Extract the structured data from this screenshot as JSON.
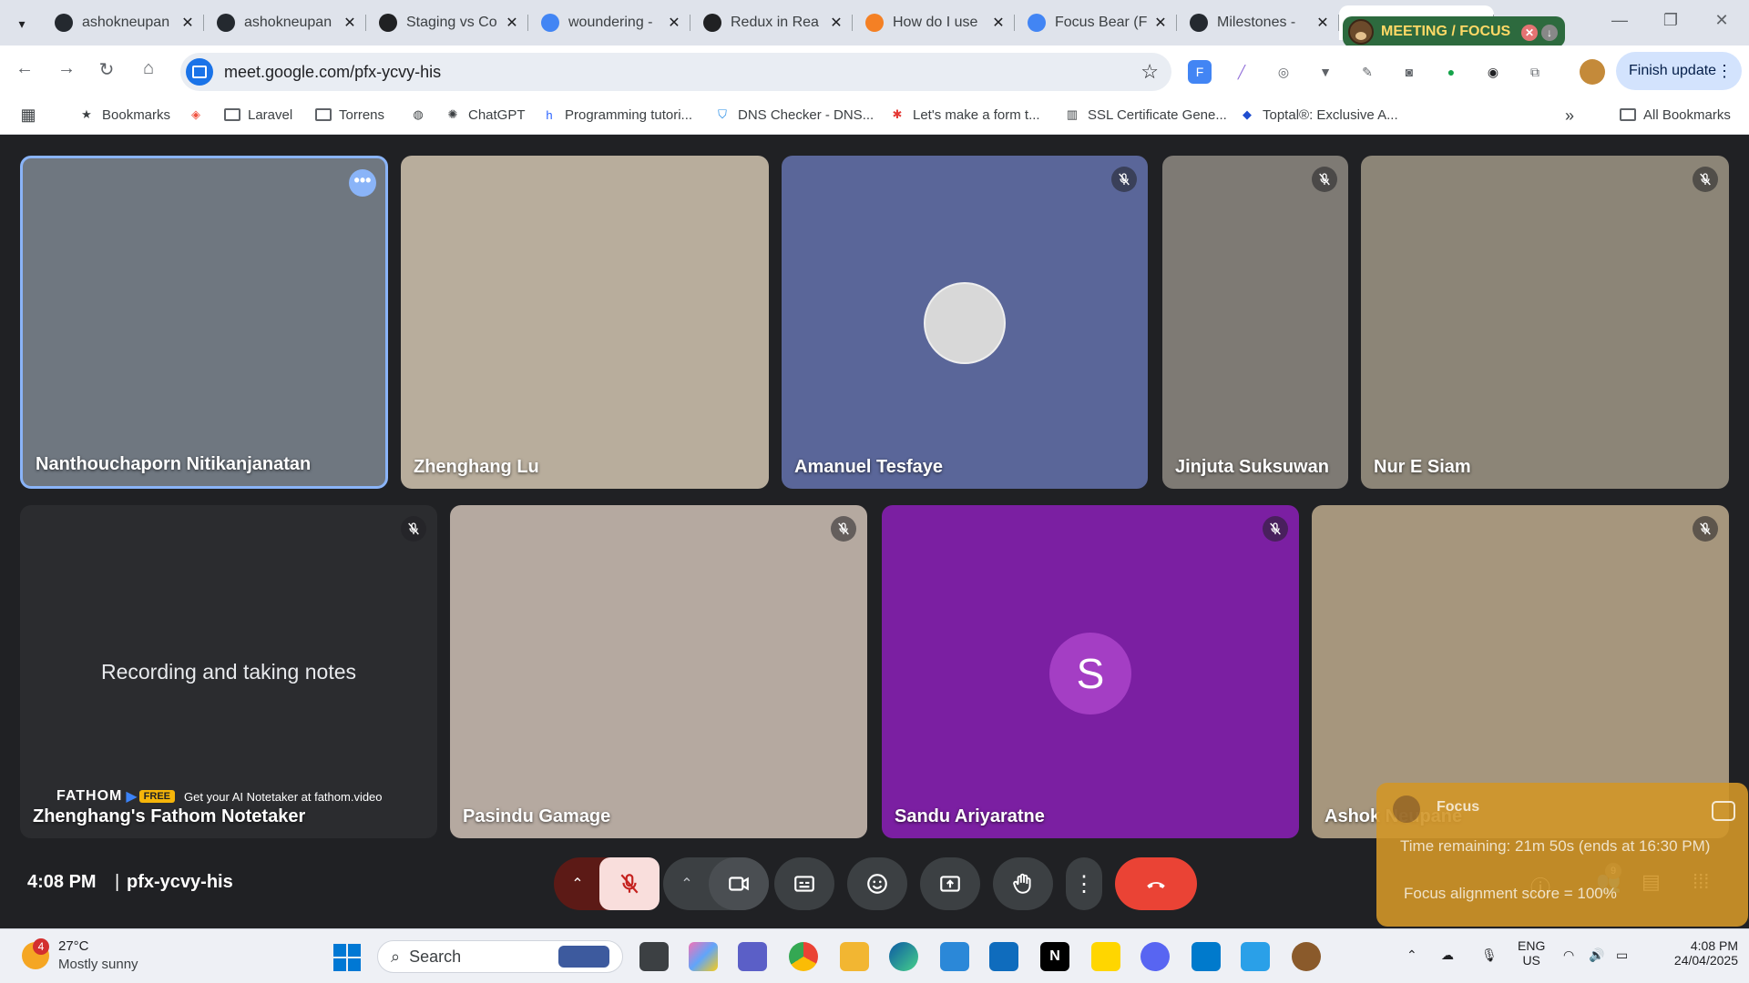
{
  "browser": {
    "tabs": [
      {
        "title": "ashokneupan",
        "favicon": "github-icon",
        "color": "#24292f"
      },
      {
        "title": "ashokneupan",
        "favicon": "github-icon",
        "color": "#24292f"
      },
      {
        "title": "Staging vs Co",
        "favicon": "openai-icon",
        "color": "#202123"
      },
      {
        "title": "woundering -",
        "favicon": "google-icon",
        "color": "#4285f4"
      },
      {
        "title": "Redux in Rea",
        "favicon": "openai-icon",
        "color": "#202123"
      },
      {
        "title": "How do I use",
        "favicon": "stackoverflow-icon",
        "color": "#f48024"
      },
      {
        "title": "Focus Bear (F",
        "favicon": "docs-icon",
        "color": "#4285f4"
      },
      {
        "title": "Milestones -",
        "favicon": "github-icon",
        "color": "#24292f"
      }
    ],
    "tab_close_symbol": "✕",
    "focus_extension_label": "MEETING / FOCUS",
    "url": "meet.google.com/pfx-ycvy-his",
    "finish_update_label": "Finish update",
    "bookmarks": [
      {
        "label": "Bookmarks",
        "icon": "star-icon"
      },
      {
        "label": "",
        "icon": "laravel-icon"
      },
      {
        "label": "Laravel",
        "icon": "folder-icon"
      },
      {
        "label": "Torrens",
        "icon": "folder-icon"
      },
      {
        "label": "",
        "icon": "globe-icon"
      },
      {
        "label": "ChatGPT",
        "icon": "openai-icon"
      },
      {
        "label": "Programming tutori...",
        "icon": "hashnode-icon"
      },
      {
        "label": "DNS Checker - DNS...",
        "icon": "shield-icon"
      },
      {
        "label": "Let's make a form t...",
        "icon": "asterisk-icon"
      },
      {
        "label": "SSL Certificate Gene...",
        "icon": "ssl-icon"
      },
      {
        "label": "Toptal®: Exclusive A...",
        "icon": "toptal-icon"
      }
    ],
    "all_bookmarks_label": "All Bookmarks"
  },
  "meet": {
    "participants_row1": [
      {
        "name": "Nanthouchaporn Nitikanjanatan",
        "bg": "#6f7780",
        "muted": false,
        "highlighted": true
      },
      {
        "name": "Zhenghang Lu",
        "bg": "#b8ad9c",
        "muted": false,
        "highlighted": false
      },
      {
        "name": "Amanuel Tesfaye",
        "bg": "#5a6699",
        "muted": true,
        "highlighted": false
      },
      {
        "name": "Jinjuta Suksuwan",
        "bg": "#7e7a74",
        "muted": true,
        "highlighted": false
      },
      {
        "name": "Nur E Siam",
        "bg": "#8c8577",
        "muted": true,
        "highlighted": false
      }
    ],
    "participants_row2": [
      {
        "name": "Zhenghang's Fathom Notetaker",
        "bg": "#2b2c2f",
        "muted": true
      },
      {
        "name": "Pasindu Gamage",
        "bg": "#b5a9a0",
        "muted": true
      },
      {
        "name": "Sandu Ariyaratne",
        "bg": "#7b1fa2",
        "muted": true
      },
      {
        "name": "Ashok Neupane",
        "bg": "#a6967d",
        "muted": true
      }
    ],
    "fathom_status": "Recording and taking notes",
    "fathom_brand": "FATHOM",
    "fathom_free": "FREE",
    "fathom_promo": "Get your AI Notetaker at fathom.video",
    "sandu_initial": "S",
    "clock": "4:08 PM",
    "separator": "|",
    "meeting_code": "pfx-ycvy-his",
    "people_count": "9"
  },
  "focus_widget": {
    "title": "Focus",
    "time_remaining": "Time remaining: 21m 50s (ends at 16:30 PM)",
    "alignment": "Focus alignment score = 100%"
  },
  "taskbar": {
    "temperature": "27°C",
    "weather": "Mostly sunny",
    "weather_badge": "4",
    "search_placeholder": "Search",
    "lang1": "ENG",
    "lang2": "US",
    "time": "4:08 PM",
    "date": "24/04/2025"
  },
  "colors": {
    "accent": "#1a73e8",
    "hangup": "#ea4335",
    "muted_btn": "#f9dedc"
  }
}
